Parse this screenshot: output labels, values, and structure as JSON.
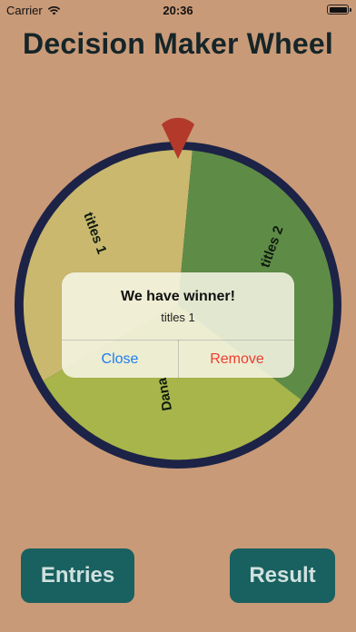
{
  "status_bar": {
    "carrier": "Carrier",
    "time": "20:36",
    "signal_icon": "wifi-icon",
    "battery_icon": "battery-icon"
  },
  "header": {
    "title": "Decision Maker Wheel"
  },
  "wheel": {
    "rim_color": "#1C2346",
    "pointer_color": "#B33A2A",
    "pointer_icon": "wheel-pointer-icon",
    "segments": [
      {
        "label": "titles 1",
        "color": "#C9B86E"
      },
      {
        "label": "titles 2",
        "color": "#5E8C46"
      },
      {
        "label": "Dana",
        "color": "#A8B54A"
      }
    ]
  },
  "alert": {
    "title": "We have winner!",
    "message": "titles 1",
    "close_label": "Close",
    "remove_label": "Remove",
    "close_color": "#1E7CF0",
    "remove_color": "#F03C30"
  },
  "actions": {
    "entries_label": "Entries",
    "result_label": "Result",
    "button_color": "#196060"
  }
}
